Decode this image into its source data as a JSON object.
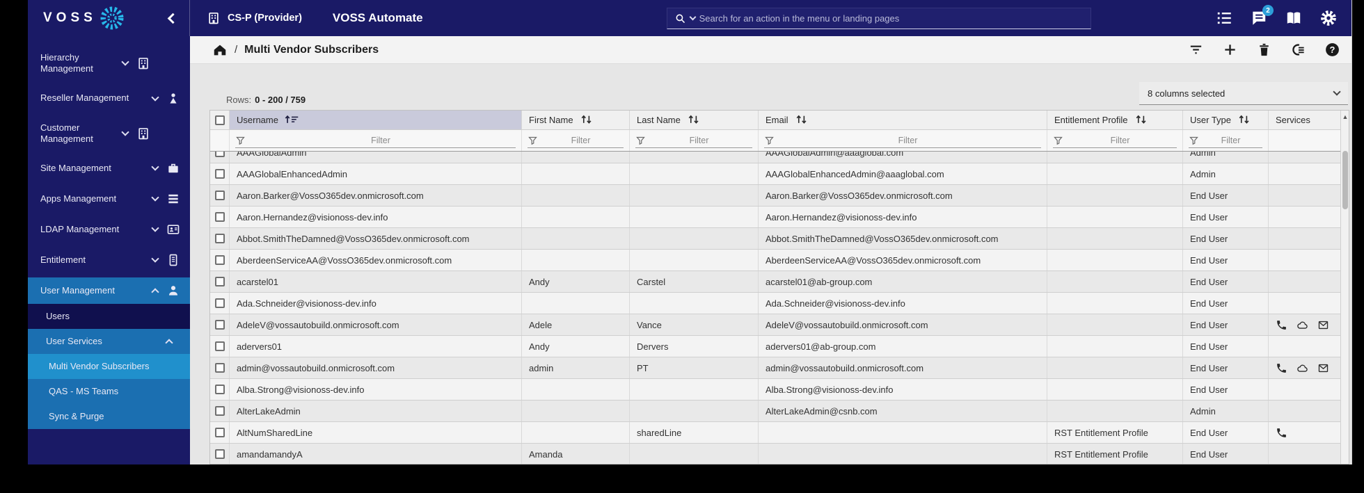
{
  "topbar": {
    "logo_text": "VOSS",
    "logo_icon": "voss-burst-icon",
    "hierarchy_label": "CS-P (Provider)",
    "app_title": "VOSS Automate",
    "search_placeholder": "Search for an action in the menu or landing pages",
    "notifications_badge": "2",
    "actions": [
      {
        "icon": "numbered-list-icon"
      },
      {
        "icon": "messages-icon",
        "badge": "2"
      },
      {
        "icon": "documentation-book-icon"
      },
      {
        "icon": "settings-gear-icon"
      }
    ]
  },
  "sidebar": {
    "items": [
      {
        "label": "Hierarchy Management",
        "icon": "building-icon",
        "chevron": "down",
        "level": 0,
        "style": "default",
        "wrap": true
      },
      {
        "label": "Reseller Management",
        "icon": "reseller-person-icon",
        "chevron": "down",
        "level": 0,
        "style": "default"
      },
      {
        "label": "Customer Management",
        "icon": "building-icon",
        "chevron": "down",
        "level": 0,
        "style": "default",
        "wrap": true
      },
      {
        "label": "Site Management",
        "icon": "briefcase-icon",
        "chevron": "down",
        "level": 0,
        "style": "default"
      },
      {
        "label": "Apps Management",
        "icon": "apps-list-icon",
        "chevron": "down",
        "level": 0,
        "style": "default"
      },
      {
        "label": "LDAP Management",
        "icon": "contact-card-icon",
        "chevron": "down",
        "level": 0,
        "style": "default"
      },
      {
        "label": "Entitlement",
        "icon": "entitlement-card-icon",
        "chevron": "down",
        "level": 0,
        "style": "default"
      },
      {
        "label": "User Management",
        "icon": "person-icon",
        "chevron": "up",
        "level": 0,
        "style": "active"
      },
      {
        "label": "Users",
        "level": 1,
        "style": "subitem"
      },
      {
        "label": "User Services",
        "chevron": "up",
        "level": 1,
        "style": "active"
      },
      {
        "label": "Multi Vendor Subscribers",
        "level": 2,
        "style": "selected"
      },
      {
        "label": "QAS - MS Teams",
        "level": 2,
        "style": "active"
      },
      {
        "label": "Sync & Purge",
        "level": 2,
        "style": "active"
      }
    ]
  },
  "breadcrumb": {
    "separator": "/",
    "current": "Multi Vendor Subscribers",
    "actions": [
      {
        "icon": "filter-list-icon"
      },
      {
        "icon": "add-icon"
      },
      {
        "icon": "delete-trash-icon"
      },
      {
        "icon": "related-items-icon"
      },
      {
        "icon": "help-icon"
      }
    ]
  },
  "table": {
    "rows_label": "Rows:",
    "rows_value": "0 - 200 / 759",
    "columns_selected": "8 columns selected",
    "filter_placeholder": "Filter",
    "columns": [
      {
        "label": "Username",
        "sort": "asc",
        "filter": true,
        "sorted": true
      },
      {
        "label": "First Name",
        "sort": "both",
        "filter": true
      },
      {
        "label": "Last Name",
        "sort": "both",
        "filter": true
      },
      {
        "label": "Email",
        "sort": "both",
        "filter": true
      },
      {
        "label": "Entitlement Profile",
        "sort": "both",
        "filter": true
      },
      {
        "label": "User Type",
        "sort": "both",
        "filter": true
      },
      {
        "label": "Services",
        "sort": "none",
        "filter": false
      }
    ],
    "rows": [
      {
        "username": "AAAGlobalAdmin",
        "first_name": "",
        "last_name": "",
        "email": "AAAGlobalAdmin@aaaglobal.com",
        "entitlement_profile": "",
        "user_type": "Admin",
        "services": []
      },
      {
        "username": "AAAGlobalEnhancedAdmin",
        "first_name": "",
        "last_name": "",
        "email": "AAAGlobalEnhancedAdmin@aaaglobal.com",
        "entitlement_profile": "",
        "user_type": "Admin",
        "services": []
      },
      {
        "username": "Aaron.Barker@VossO365dev.onmicrosoft.com",
        "first_name": "",
        "last_name": "",
        "email": "Aaron.Barker@VossO365dev.onmicrosoft.com",
        "entitlement_profile": "",
        "user_type": "End User",
        "services": []
      },
      {
        "username": "Aaron.Hernandez@visionoss-dev.info",
        "first_name": "",
        "last_name": "",
        "email": "Aaron.Hernandez@visionoss-dev.info",
        "entitlement_profile": "",
        "user_type": "End User",
        "services": []
      },
      {
        "username": "Abbot.SmithTheDamned@VossO365dev.onmicrosoft.com",
        "first_name": "",
        "last_name": "",
        "email": "Abbot.SmithTheDamned@VossO365dev.onmicrosoft.com",
        "entitlement_profile": "",
        "user_type": "End User",
        "services": []
      },
      {
        "username": "AberdeenServiceAA@VossO365dev.onmicrosoft.com",
        "first_name": "",
        "last_name": "",
        "email": "AberdeenServiceAA@VossO365dev.onmicrosoft.com",
        "entitlement_profile": "",
        "user_type": "End User",
        "services": []
      },
      {
        "username": "acarstel01",
        "first_name": "Andy",
        "last_name": "Carstel",
        "email": "acarstel01@ab-group.com",
        "entitlement_profile": "",
        "user_type": "End User",
        "services": []
      },
      {
        "username": "Ada.Schneider@visionoss-dev.info",
        "first_name": "",
        "last_name": "",
        "email": "Ada.Schneider@visionoss-dev.info",
        "entitlement_profile": "",
        "user_type": "End User",
        "services": []
      },
      {
        "username": "AdeleV@vossautobuild.onmicrosoft.com",
        "first_name": "Adele",
        "last_name": "Vance",
        "email": "AdeleV@vossautobuild.onmicrosoft.com",
        "entitlement_profile": "",
        "user_type": "End User",
        "services": [
          "phone-icon",
          "cloud-icon",
          "mail-icon"
        ]
      },
      {
        "username": "adervers01",
        "first_name": "Andy",
        "last_name": "Dervers",
        "email": "adervers01@ab-group.com",
        "entitlement_profile": "",
        "user_type": "End User",
        "services": []
      },
      {
        "username": "admin@vossautobuild.onmicrosoft.com",
        "first_name": "admin",
        "last_name": "PT",
        "email": "admin@vossautobuild.onmicrosoft.com",
        "entitlement_profile": "",
        "user_type": "End User",
        "services": [
          "phone-icon",
          "cloud-icon",
          "mail-icon"
        ]
      },
      {
        "username": "Alba.Strong@visionoss-dev.info",
        "first_name": "",
        "last_name": "",
        "email": "Alba.Strong@visionoss-dev.info",
        "entitlement_profile": "",
        "user_type": "End User",
        "services": []
      },
      {
        "username": "AlterLakeAdmin",
        "first_name": "",
        "last_name": "",
        "email": "AlterLakeAdmin@csnb.com",
        "entitlement_profile": "",
        "user_type": "Admin",
        "services": []
      },
      {
        "username": "AltNumSharedLine",
        "first_name": "",
        "last_name": "sharedLine",
        "email": "",
        "entitlement_profile": "RST Entitlement Profile",
        "user_type": "End User",
        "services": [
          "phone-icon"
        ]
      },
      {
        "username": "amandamandyA",
        "first_name": "Amanda",
        "last_name": "",
        "email": "",
        "entitlement_profile": "RST Entitlement Profile",
        "user_type": "End User",
        "services": []
      }
    ]
  }
}
